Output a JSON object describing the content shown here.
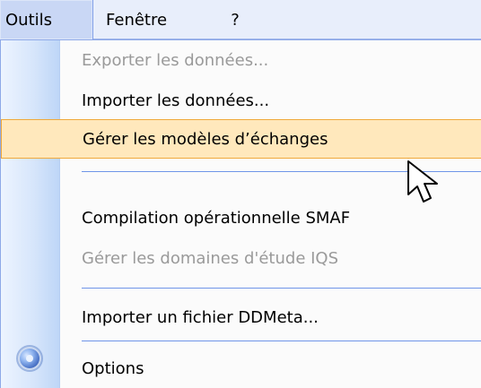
{
  "menubar": {
    "items": [
      {
        "label": "Outils"
      },
      {
        "label": "Fenêtre"
      },
      {
        "label": "?"
      }
    ]
  },
  "menu": {
    "items": [
      {
        "label": "Exporter les données..."
      },
      {
        "label": "Importer les données..."
      },
      {
        "label": "Gérer les modèles d’échanges"
      },
      {
        "label": "Compilation opérationnelle SMAF"
      },
      {
        "label": "Gérer les domaines d'étude IQS"
      },
      {
        "label": "Importer un fichier DDMeta..."
      },
      {
        "label": "Options"
      }
    ]
  },
  "icons": {
    "options": "gear-icon",
    "cursor": "mouse-pointer-icon"
  },
  "colors": {
    "menubar_bg": "#e8eefb",
    "active_menubar_bg": "#c9d7f5",
    "dropdown_bg": "#fbfbfb",
    "selected_bg": "#ffe8bc",
    "selected_border": "#f0a93a",
    "separator": "#6f95e8",
    "disabled_text": "#9a9a9a"
  }
}
